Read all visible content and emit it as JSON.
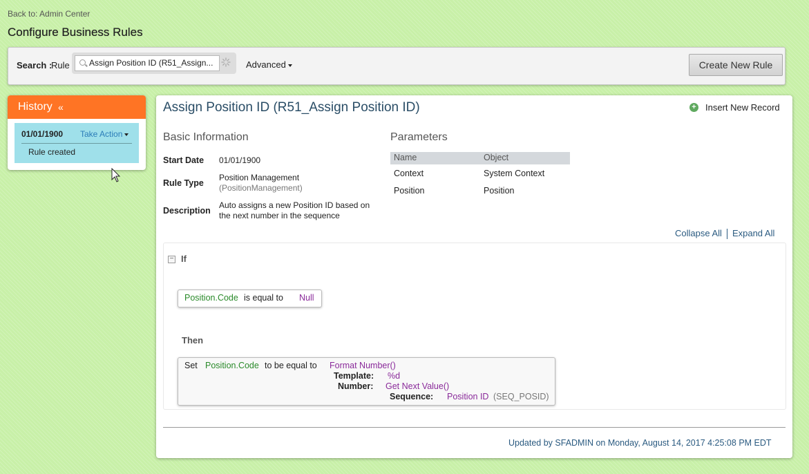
{
  "nav": {
    "back_link": "Back to: Admin Center"
  },
  "page": {
    "title": "Configure Business Rules"
  },
  "search": {
    "label": "Search :",
    "type": "Rule",
    "value": "Assign Position ID (R51_Assign...",
    "advanced_label": "Advanced",
    "create_button": "Create New Rule"
  },
  "history": {
    "title": "History",
    "collapse_glyph": "«",
    "entries": [
      {
        "date": "01/01/1900",
        "action": "Take Action",
        "note": "Rule created"
      }
    ]
  },
  "rule": {
    "title": "Assign Position ID (R51_Assign Position ID)",
    "insert_record": "Insert New Record",
    "basic_info": {
      "heading": "Basic Information",
      "start_date_label": "Start Date",
      "start_date": "01/01/1900",
      "rule_type_label": "Rule Type",
      "rule_type": "Position Management",
      "rule_type_code": "(PositionManagement)",
      "description_label": "Description",
      "description_line1": "Auto assigns a new Position ID based on",
      "description_line2": "the next number in the sequence"
    },
    "parameters": {
      "heading": "Parameters",
      "columns": [
        "Name",
        "Object"
      ],
      "rows": [
        [
          "Context",
          "System Context"
        ],
        [
          "Position",
          "Position"
        ]
      ]
    },
    "collapse_all": "Collapse All",
    "expand_all": "Expand All",
    "if_label": "If",
    "condition": {
      "field": "Position.Code",
      "operator": "is equal to",
      "value": "Null"
    },
    "then_label": "Then",
    "action": {
      "verb": "Set",
      "field": "Position.Code",
      "operator": "to be equal to",
      "function": "Format Number()",
      "template_label": "Template:",
      "template_value": "%d",
      "number_label": "Number:",
      "number_value": "Get Next Value()",
      "sequence_label": "Sequence:",
      "sequence_value": "Position ID",
      "sequence_code": "(SEQ_POSID)"
    },
    "footer": "Updated by SFADMIN on Monday, August 14, 2017 4:25:08 PM EDT"
  },
  "colors": {
    "background": "#c8f0a8",
    "history_header": "#ff7424",
    "history_entry": "#9fe0ea",
    "field_green": "#2a8a2a",
    "value_purple": "#8a2a9a",
    "link_blue": "#2a7cb8"
  },
  "icons": [
    "search-icon",
    "loading-icon",
    "chevron-down-icon",
    "plus-circle-icon",
    "collapse-minus-icon",
    "mouse-cursor-icon"
  ]
}
